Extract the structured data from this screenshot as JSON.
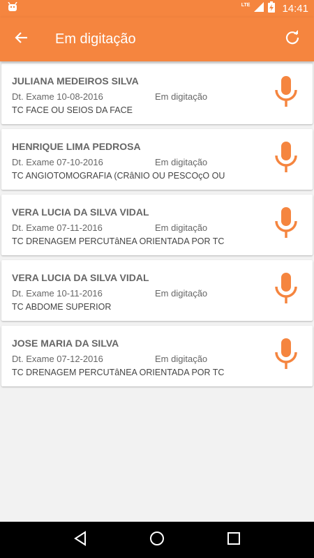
{
  "status_bar": {
    "network": "LTE",
    "time": "14:41",
    "icons": [
      "android-notification-icon",
      "signal-icon",
      "battery-charging-icon"
    ]
  },
  "app_bar": {
    "title": "Em digitação",
    "back_icon": "arrow-back-icon",
    "refresh_icon": "refresh-icon"
  },
  "colors": {
    "primary": "#f5853f",
    "mic": "#f5853f",
    "background": "#f2f2f2"
  },
  "items": [
    {
      "name": "JULIANA MEDEIROS SILVA",
      "date": "Dt. Exame 10-08-2016",
      "status": "Em digitação",
      "exam": "TC FACE OU SEIOS DA FACE"
    },
    {
      "name": "HENRIQUE LIMA PEDROSA",
      "date": "Dt. Exame 07-10-2016",
      "status": "Em digitação",
      "exam": "TC ANGIOTOMOGRAFIA (CRâNIO OU PESCOçO OU"
    },
    {
      "name": "VERA LUCIA DA SILVA VIDAL",
      "date": "Dt. Exame 07-11-2016",
      "status": "Em digitação",
      "exam": "TC DRENAGEM PERCUTâNEA ORIENTADA POR TC"
    },
    {
      "name": "VERA LUCIA DA SILVA VIDAL",
      "date": "Dt. Exame 10-11-2016",
      "status": "Em digitação",
      "exam": "TC ABDOME SUPERIOR"
    },
    {
      "name": "JOSE MARIA DA SILVA",
      "date": "Dt. Exame 07-12-2016",
      "status": "Em digitação",
      "exam": "TC DRENAGEM PERCUTâNEA ORIENTADA POR TC"
    }
  ],
  "nav_bar": {
    "icons": [
      "back-triangle-icon",
      "home-circle-icon",
      "recents-square-icon"
    ]
  }
}
